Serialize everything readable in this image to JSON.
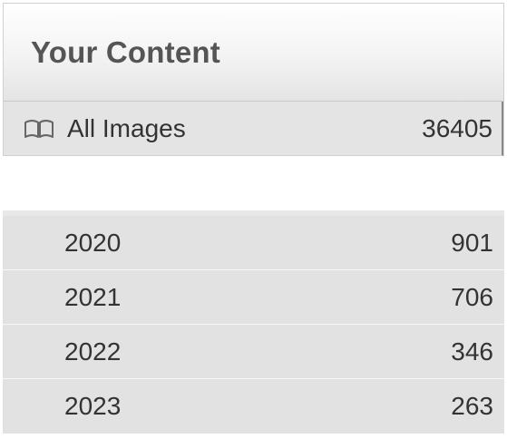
{
  "panel": {
    "title": "Your Content",
    "all_images": {
      "icon": "book-icon",
      "label": "All Images",
      "count": "36405"
    }
  },
  "years": [
    {
      "year": "2020",
      "count": "901"
    },
    {
      "year": "2021",
      "count": "706"
    },
    {
      "year": "2022",
      "count": "346"
    },
    {
      "year": "2023",
      "count": "263"
    }
  ]
}
